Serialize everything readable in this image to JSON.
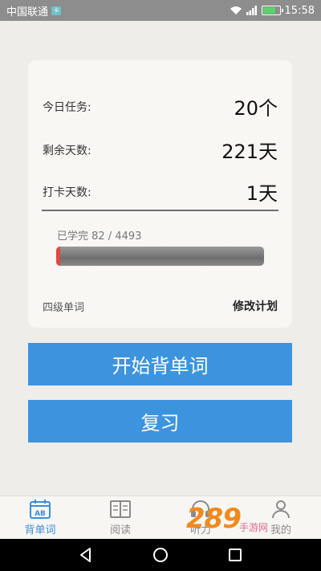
{
  "status_bar": {
    "carrier": "中国联通",
    "time": "15:58"
  },
  "stats": [
    {
      "label": "今日任务:",
      "value": "20个"
    },
    {
      "label": "剩余天数:",
      "value": "221天"
    },
    {
      "label": "打卡天数:",
      "value": "1天"
    }
  ],
  "progress": {
    "label": "已学完 82 / 4493",
    "learned": 82,
    "total": 4493
  },
  "plan": {
    "level_name": "四级单词",
    "edit_label": "修改计划"
  },
  "buttons": {
    "start_label": "开始背单词",
    "review_label": "复习"
  },
  "tabs": [
    {
      "label": "背单词",
      "icon": "calendar-ab-icon",
      "active": true
    },
    {
      "label": "阅读",
      "icon": "book-icon",
      "active": false
    },
    {
      "label": "听力",
      "icon": "headphones-icon",
      "active": false
    },
    {
      "label": "我的",
      "icon": "person-icon",
      "active": false
    }
  ],
  "watermark": {
    "logo": "289",
    "text": "手游网"
  },
  "colors": {
    "accent": "#3d94de",
    "tab_active": "#3d8fd9",
    "progress_fill": "#e04a3a"
  }
}
